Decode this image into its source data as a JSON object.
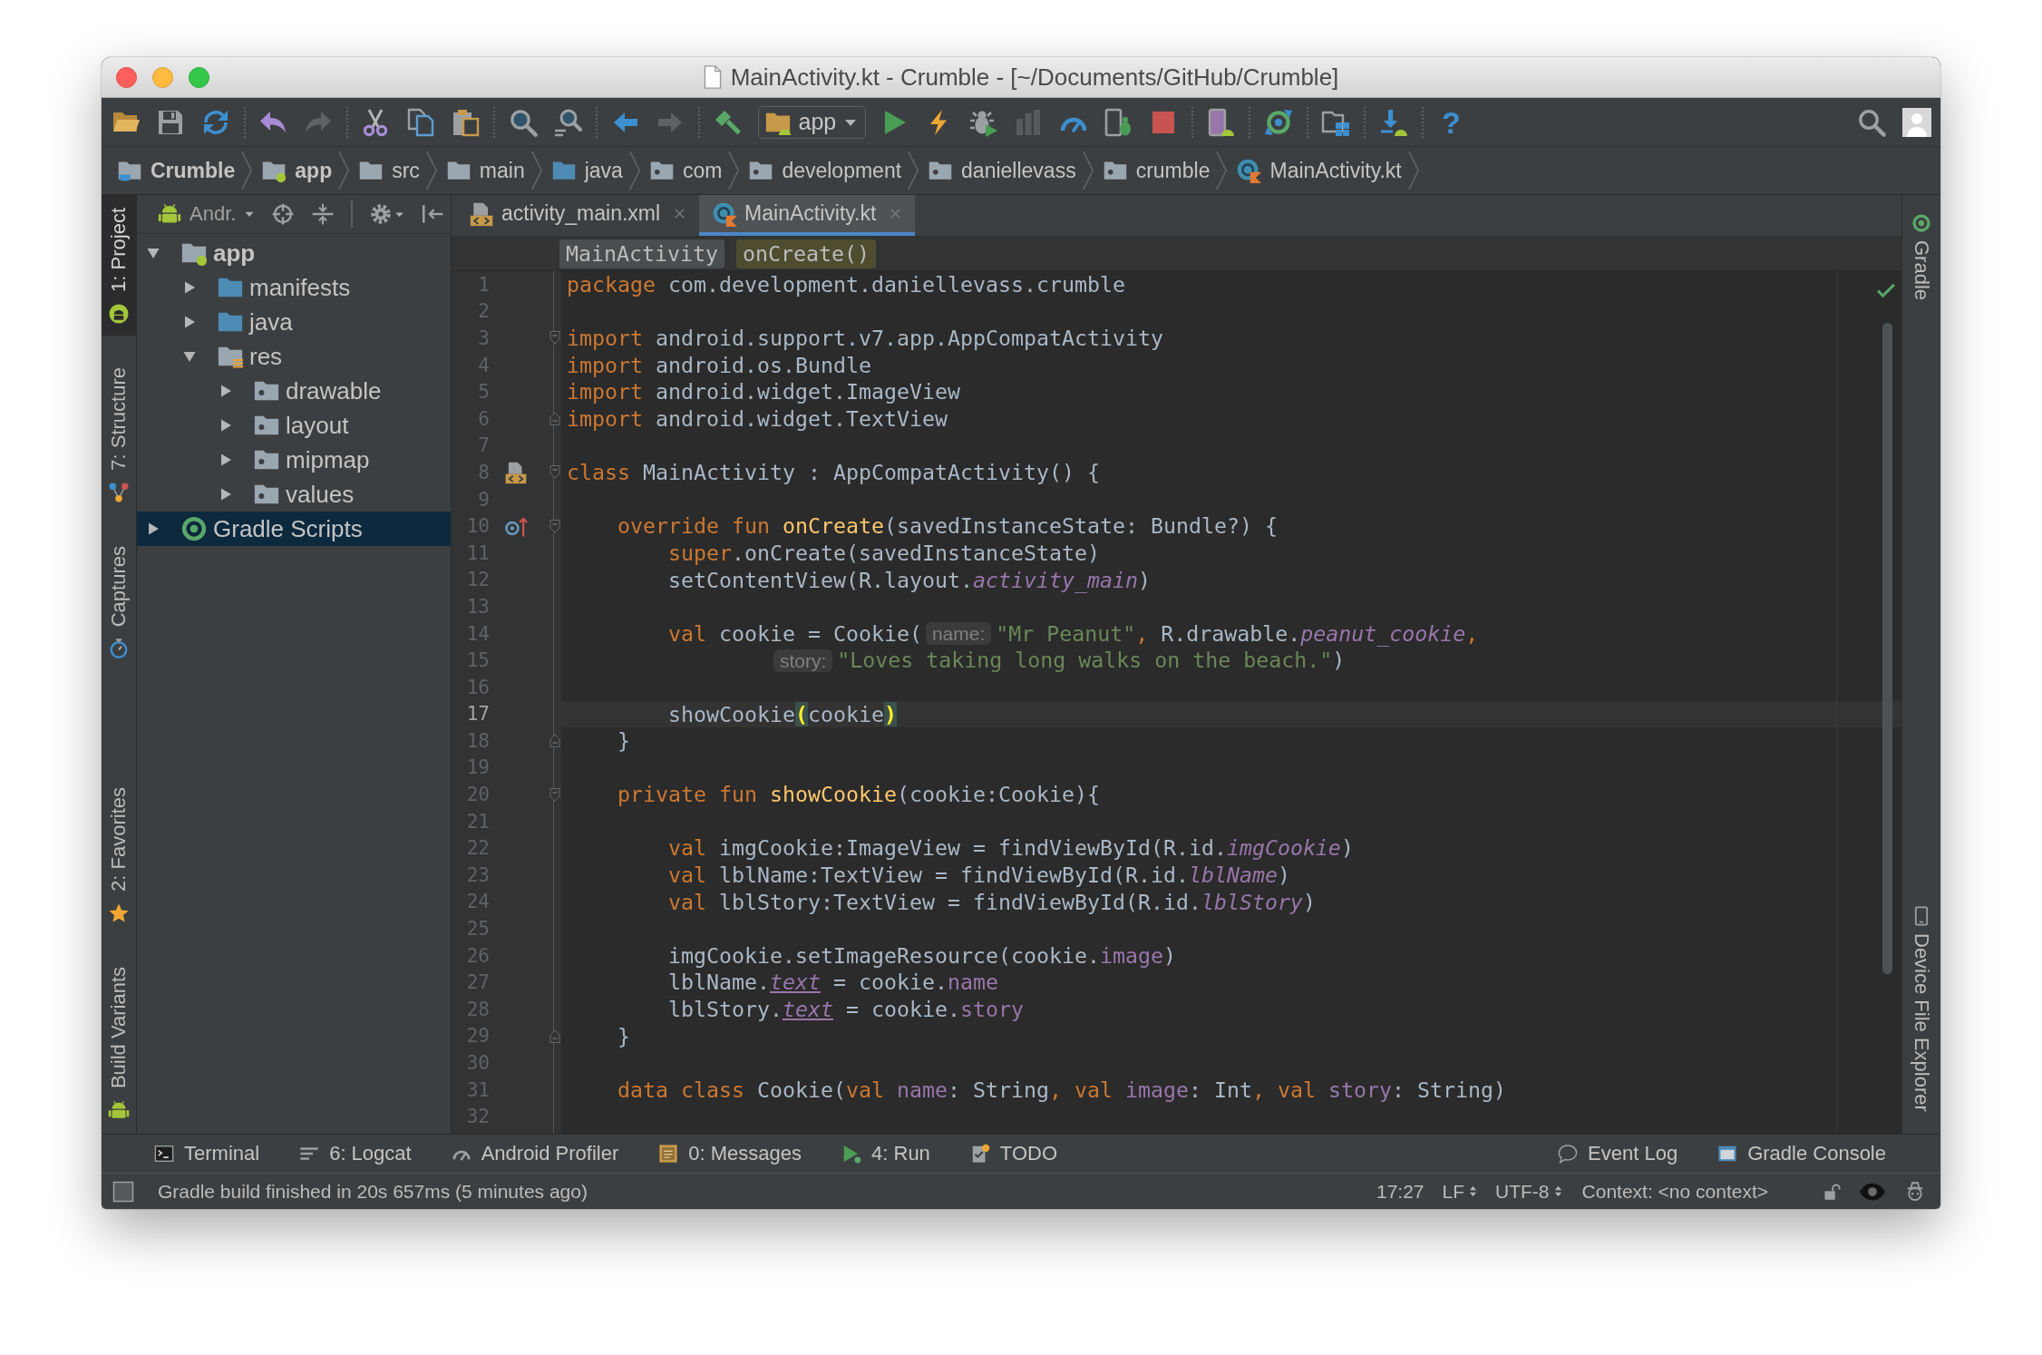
{
  "window": {
    "title": "MainActivity.kt - Crumble - [~/Documents/GitHub/Crumble]"
  },
  "toolbar": {
    "groups": [
      [
        {
          "kind": "open",
          "disabled": false
        },
        {
          "kind": "save",
          "disabled": false
        },
        {
          "kind": "sync",
          "disabled": false
        }
      ],
      [
        {
          "kind": "undo",
          "disabled": false
        },
        {
          "kind": "redo",
          "disabled": true
        }
      ],
      [
        {
          "kind": "cut",
          "disabled": false
        },
        {
          "kind": "copy",
          "disabled": false
        },
        {
          "kind": "paste",
          "disabled": false
        }
      ],
      [
        {
          "kind": "find",
          "disabled": false
        },
        {
          "kind": "replace",
          "disabled": false
        }
      ],
      [
        {
          "kind": "back",
          "disabled": false
        },
        {
          "kind": "forward",
          "disabled": true
        }
      ],
      [
        {
          "kind": "make",
          "disabled": false
        },
        {
          "kind": "run_config",
          "label": "app",
          "disabled": false
        },
        {
          "kind": "run",
          "disabled": false
        },
        {
          "kind": "apply",
          "disabled": false
        },
        {
          "kind": "debug",
          "disabled": false
        },
        {
          "kind": "coverage",
          "disabled": true
        },
        {
          "kind": "profile",
          "disabled": false
        },
        {
          "kind": "attach",
          "disabled": false
        },
        {
          "kind": "stop",
          "disabled": false
        }
      ],
      [
        {
          "kind": "avd",
          "disabled": false
        }
      ],
      [
        {
          "kind": "gradle_sync",
          "disabled": false
        }
      ],
      [
        {
          "kind": "structure",
          "disabled": false
        }
      ],
      [
        {
          "kind": "sdk",
          "disabled": false
        }
      ],
      [
        {
          "kind": "help",
          "label": "?",
          "disabled": false
        }
      ]
    ],
    "right": [
      {
        "kind": "search"
      },
      {
        "kind": "user"
      }
    ]
  },
  "breadcrumbs": [
    {
      "label": "Crumble",
      "kind": "project"
    },
    {
      "label": "app",
      "kind": "module"
    },
    {
      "label": "src",
      "kind": "folder"
    },
    {
      "label": "main",
      "kind": "folder"
    },
    {
      "label": "java",
      "kind": "source"
    },
    {
      "label": "com",
      "kind": "package"
    },
    {
      "label": "development",
      "kind": "package"
    },
    {
      "label": "daniellevass",
      "kind": "package"
    },
    {
      "label": "crumble",
      "kind": "package"
    },
    {
      "label": "MainActivity.kt",
      "kind": "kotlin"
    }
  ],
  "left_strip": {
    "top": [
      {
        "label": "1: Project",
        "kind": "project",
        "selected": true
      },
      {
        "label": "7: Structure",
        "kind": "structure",
        "selected": false
      },
      {
        "label": "Captures",
        "kind": "captures",
        "selected": false
      }
    ],
    "bottom": [
      {
        "label": "2: Favorites",
        "kind": "favorites",
        "selected": false
      },
      {
        "label": "Build Variants",
        "kind": "variants",
        "selected": false
      }
    ]
  },
  "project_panel": {
    "view": "Andr.",
    "tree": [
      {
        "label": "app",
        "kind": "module",
        "expanded": true,
        "selected": false,
        "children": [
          {
            "label": "manifests",
            "kind": "source",
            "expanded": false,
            "selected": false
          },
          {
            "label": "java",
            "kind": "source",
            "expanded": false,
            "selected": false
          },
          {
            "label": "res",
            "kind": "res",
            "expanded": true,
            "selected": false,
            "children": [
              {
                "label": "drawable",
                "kind": "package",
                "expanded": false,
                "selected": false
              },
              {
                "label": "layout",
                "kind": "package",
                "expanded": false,
                "selected": false
              },
              {
                "label": "mipmap",
                "kind": "package",
                "expanded": false,
                "selected": false
              },
              {
                "label": "values",
                "kind": "package",
                "expanded": false,
                "selected": false
              }
            ]
          }
        ]
      },
      {
        "label": "Gradle Scripts",
        "kind": "gradle",
        "expanded": false,
        "selected": true
      }
    ]
  },
  "editor": {
    "tabs": [
      {
        "label": "activity_main.xml",
        "kind": "xml",
        "selected": false
      },
      {
        "label": "MainActivity.kt",
        "kind": "kotlin",
        "selected": true
      }
    ],
    "crumbs": [
      {
        "label": "MainActivity",
        "selected": false
      },
      {
        "label": "onCreate()",
        "selected": true
      }
    ],
    "lines": [
      {
        "number": "1",
        "current": false,
        "continuation": false,
        "tokens": [
          {
            "kind": "keyword",
            "text": "package"
          },
          {
            "kind": "plain",
            "text": " com.development.daniellevass.crumble"
          }
        ]
      },
      {
        "number": "2",
        "current": false
      },
      {
        "number": "3",
        "current": false,
        "continuation": false,
        "markers": [
          {
            "kind": "fold_start"
          }
        ],
        "tokens": [
          {
            "kind": "keyword",
            "text": "import"
          },
          {
            "kind": "plain",
            "text": " android.support.v7.app.AppCompatActivity"
          }
        ]
      },
      {
        "number": "4",
        "current": false,
        "continuation": false,
        "tokens": [
          {
            "kind": "keyword",
            "text": "import"
          },
          {
            "kind": "plain",
            "text": " android.os.Bundle"
          }
        ]
      },
      {
        "number": "5",
        "current": false,
        "continuation": false,
        "tokens": [
          {
            "kind": "keyword",
            "text": "import"
          },
          {
            "kind": "plain",
            "text": " android.widget.ImageView"
          }
        ]
      },
      {
        "number": "6",
        "current": false,
        "continuation": false,
        "markers": [
          {
            "kind": "fold_end"
          }
        ],
        "tokens": [
          {
            "kind": "keyword",
            "text": "import"
          },
          {
            "kind": "plain",
            "text": " android.widget.TextView"
          }
        ]
      },
      {
        "number": "7",
        "current": false
      },
      {
        "number": "8",
        "current": false,
        "continuation": false,
        "markers": [
          {
            "kind": "layout"
          },
          {
            "kind": "fold_start"
          }
        ],
        "tokens": [
          {
            "kind": "keyword",
            "text": "class"
          },
          {
            "kind": "plain",
            "text": " MainActivity : AppCompatActivity() {"
          }
        ],
        "children": [
          {
            "number": "9",
            "current": false
          },
          {
            "number": "10",
            "current": false,
            "continuation": false,
            "markers": [
              {
                "kind": "override"
              },
              {
                "kind": "fold_start"
              }
            ],
            "tokens": [
              {
                "kind": "keyword",
                "text": "override fun "
              },
              {
                "kind": "decl",
                "text": "onCreate"
              },
              {
                "kind": "plain",
                "text": "(savedInstanceState: Bundle?) {"
              }
            ],
            "children": [
              {
                "number": "11",
                "current": false,
                "continuation": false,
                "tokens": [
                  {
                    "kind": "keyword",
                    "text": "super"
                  },
                  {
                    "kind": "plain",
                    "text": ".onCreate(savedInstanceState)"
                  }
                ]
              },
              {
                "number": "12",
                "current": false,
                "continuation": false,
                "tokens": [
                  {
                    "kind": "plain",
                    "text": "setContentView(R.layout."
                  },
                  {
                    "kind": "field",
                    "text": "activity_main"
                  },
                  {
                    "kind": "plain",
                    "text": ")"
                  }
                ]
              },
              {
                "number": "13",
                "current": false
              },
              {
                "number": "14",
                "current": false,
                "continuation": false,
                "tokens": [
                  {
                    "kind": "keyword",
                    "text": "val "
                  },
                  {
                    "kind": "plain",
                    "text": "cookie = Cookie("
                  },
                  {
                    "kind": "hint",
                    "text": "name:"
                  },
                  {
                    "kind": "string",
                    "text": "\"Mr Peanut\""
                  },
                  {
                    "kind": "delimiter",
                    "text": ", "
                  },
                  {
                    "kind": "plain",
                    "text": "R.drawable."
                  },
                  {
                    "kind": "field",
                    "text": "peanut_cookie"
                  },
                  {
                    "kind": "delimiter",
                    "text": ","
                  }
                ]
              },
              {
                "number": "15",
                "current": false,
                "continuation": true,
                "tokens": [
                  {
                    "kind": "hint",
                    "text": "story:"
                  },
                  {
                    "kind": "string",
                    "text": "\"Loves taking long walks on the beach.\""
                  },
                  {
                    "kind": "plain",
                    "text": ")"
                  }
                ]
              },
              {
                "number": "16",
                "current": false
              },
              {
                "number": "17",
                "current": true,
                "continuation": false,
                "tokens": [
                  {
                    "kind": "plain",
                    "text": "showCookie"
                  },
                  {
                    "kind": "match",
                    "text": "("
                  },
                  {
                    "kind": "plain",
                    "text": "cookie"
                  },
                  {
                    "kind": "match",
                    "text": ")"
                  }
                ]
              }
            ]
          },
          {
            "number": "18",
            "current": false,
            "continuation": false,
            "markers": [
              {
                "kind": "fold_end"
              }
            ],
            "tokens": [
              {
                "kind": "plain",
                "text": "}"
              }
            ]
          },
          {
            "number": "19",
            "current": false
          },
          {
            "number": "20",
            "current": false,
            "continuation": false,
            "markers": [
              {
                "kind": "fold_start"
              }
            ],
            "tokens": [
              {
                "kind": "keyword",
                "text": "private fun "
              },
              {
                "kind": "decl",
                "text": "showCookie"
              },
              {
                "kind": "plain",
                "text": "(cookie:Cookie){"
              }
            ],
            "children": [
              {
                "number": "21",
                "current": false
              },
              {
                "number": "22",
                "current": false,
                "continuation": false,
                "tokens": [
                  {
                    "kind": "keyword",
                    "text": "val "
                  },
                  {
                    "kind": "plain",
                    "text": "imgCookie:ImageView = findViewById(R.id."
                  },
                  {
                    "kind": "field",
                    "text": "imgCookie"
                  },
                  {
                    "kind": "plain",
                    "text": ")"
                  }
                ]
              },
              {
                "number": "23",
                "current": false,
                "continuation": false,
                "tokens": [
                  {
                    "kind": "keyword",
                    "text": "val "
                  },
                  {
                    "kind": "plain",
                    "text": "lblName:TextView = findViewById(R.id."
                  },
                  {
                    "kind": "field",
                    "text": "lblName"
                  },
                  {
                    "kind": "plain",
                    "text": ")"
                  }
                ]
              },
              {
                "number": "24",
                "current": false,
                "continuation": false,
                "tokens": [
                  {
                    "kind": "keyword",
                    "text": "val "
                  },
                  {
                    "kind": "plain",
                    "text": "lblStory:TextView = findViewById(R.id."
                  },
                  {
                    "kind": "field",
                    "text": "lblStory"
                  },
                  {
                    "kind": "plain",
                    "text": ")"
                  }
                ]
              },
              {
                "number": "25",
                "current": false
              },
              {
                "number": "26",
                "current": false,
                "continuation": false,
                "tokens": [
                  {
                    "kind": "plain",
                    "text": "imgCookie.setImageResource(cookie."
                  },
                  {
                    "kind": "prop",
                    "text": "image"
                  },
                  {
                    "kind": "plain",
                    "text": ")"
                  }
                ]
              },
              {
                "number": "27",
                "current": false,
                "continuation": false,
                "tokens": [
                  {
                    "kind": "plain",
                    "text": "lblName."
                  },
                  {
                    "kind": "synthetic",
                    "text": "text"
                  },
                  {
                    "kind": "plain",
                    "text": " = cookie."
                  },
                  {
                    "kind": "prop",
                    "text": "name"
                  }
                ]
              },
              {
                "number": "28",
                "current": false,
                "continuation": false,
                "tokens": [
                  {
                    "kind": "plain",
                    "text": "lblStory."
                  },
                  {
                    "kind": "synthetic",
                    "text": "text"
                  },
                  {
                    "kind": "plain",
                    "text": " = cookie."
                  },
                  {
                    "kind": "prop",
                    "text": "story"
                  }
                ]
              }
            ]
          },
          {
            "number": "29",
            "current": false,
            "continuation": false,
            "markers": [
              {
                "kind": "fold_end"
              }
            ],
            "tokens": [
              {
                "kind": "plain",
                "text": "}"
              }
            ]
          },
          {
            "number": "30",
            "current": false
          },
          {
            "number": "31",
            "current": false,
            "continuation": false,
            "tokens": [
              {
                "kind": "keyword",
                "text": "data class "
              },
              {
                "kind": "plain",
                "text": "Cookie("
              },
              {
                "kind": "keyword",
                "text": "val "
              },
              {
                "kind": "prop",
                "text": "name"
              },
              {
                "kind": "plain",
                "text": ": String"
              },
              {
                "kind": "delimiter",
                "text": ", "
              },
              {
                "kind": "keyword",
                "text": "val "
              },
              {
                "kind": "prop",
                "text": "image"
              },
              {
                "kind": "plain",
                "text": ": Int"
              },
              {
                "kind": "delimiter",
                "text": ", "
              },
              {
                "kind": "keyword",
                "text": "val "
              },
              {
                "kind": "prop",
                "text": "story"
              },
              {
                "kind": "plain",
                "text": ": String)"
              }
            ]
          }
        ]
      },
      {
        "number": "32",
        "current": false
      }
    ]
  },
  "right_strip": {
    "top": [
      {
        "label": "Gradle",
        "kind": "gradle"
      }
    ],
    "bottom": [
      {
        "label": "Device File Explorer",
        "kind": "device"
      }
    ]
  },
  "tool_buttons": {
    "left": [
      {
        "label": "Terminal",
        "kind": "terminal"
      },
      {
        "label": "6: Logcat",
        "kind": "logcat"
      },
      {
        "label": "Android Profiler",
        "kind": "profiler"
      },
      {
        "label": "0: Messages",
        "kind": "messages"
      },
      {
        "label": "4: Run",
        "kind": "run"
      },
      {
        "label": "TODO",
        "kind": "todo"
      }
    ],
    "right": [
      {
        "label": "Event Log",
        "kind": "event_log"
      },
      {
        "label": "Gradle Console",
        "kind": "console"
      }
    ]
  },
  "status_bar": {
    "message": "Gradle build finished in 20s 657ms (5 minutes ago)",
    "position": "17:27",
    "line_separator": "LF",
    "encoding": "UTF-8",
    "context": "Context: <no context>"
  }
}
